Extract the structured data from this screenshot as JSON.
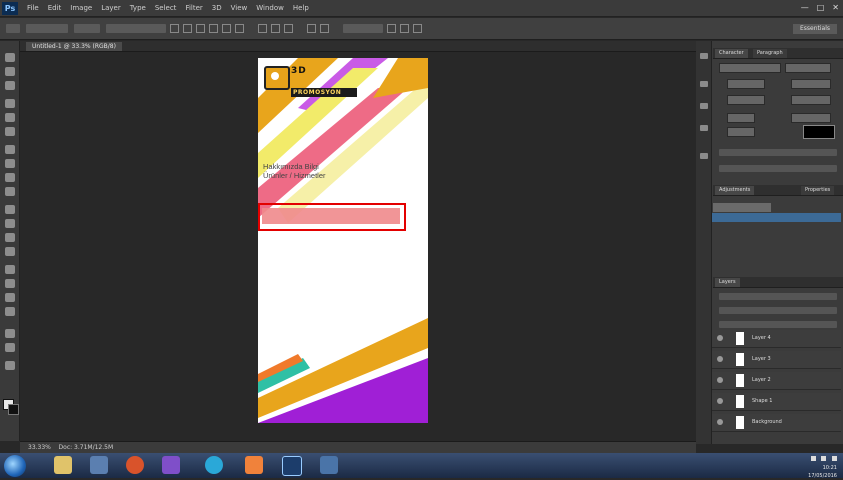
{
  "menubar": {
    "app_logo": "Ps",
    "menus": [
      "File",
      "Edit",
      "Image",
      "Layer",
      "Type",
      "Select",
      "Filter",
      "3D",
      "View",
      "Window",
      "Help"
    ],
    "window_controls": [
      "—",
      "□",
      "✕"
    ]
  },
  "optionsbar": {
    "workspace_label": "Essentials"
  },
  "document": {
    "tab_title": "Untitled-1 @ 33.3% (RGB/8)",
    "brand_line1": "3D",
    "brand_line2": "PROMOSYON",
    "headline_line1": "Hakkımızda Bilgi",
    "headline_line2": "Ürünler / Hizmetler"
  },
  "canvas_colors": {
    "stripe_gold": "#e8a51c",
    "stripe_pink": "#ee6b86",
    "stripe_yellow": "#f2eb6a",
    "stripe_purple": "#c95be6",
    "bottom_purple": "#a01fd6",
    "selection_red": "#e30000"
  },
  "right_panel": {
    "character_tab": "Character",
    "paragraph_tab": "Paragraph",
    "adjust_tab": "Adjustments",
    "properties_tab": "Properties",
    "layers_tab": "Layers",
    "layers": [
      {
        "name": "Layer 4"
      },
      {
        "name": "Layer 3"
      },
      {
        "name": "Layer 2"
      },
      {
        "name": "Shape 1"
      },
      {
        "name": "Background"
      }
    ]
  },
  "status": {
    "zoom": "33.33%",
    "doc_size": "Doc: 3.71M/12.5M"
  },
  "taskbar": {
    "time": "10:21",
    "date": "17/05/2016"
  }
}
